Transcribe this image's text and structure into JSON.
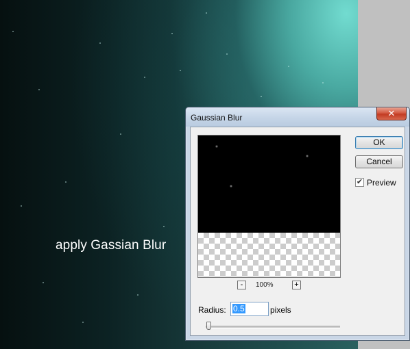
{
  "canvas": {
    "caption": "apply Gassian Blur"
  },
  "dialog": {
    "title": "Gaussian Blur",
    "close_icon": "close-icon",
    "ok_label": "OK",
    "cancel_label": "Cancel",
    "preview_checkbox": {
      "label": "Preview",
      "checked": true
    },
    "zoom": {
      "minus": "-",
      "level": "100%",
      "plus": "+"
    },
    "radius": {
      "label": "Radius:",
      "value": "0.5",
      "unit": "pixels",
      "slider_fraction": 0.005
    }
  },
  "colors": {
    "titlebar": "#c7d6e8",
    "close_button": "#c9442c",
    "accent_selection": "#3399ff",
    "canvas_glow": "#6ddcd2"
  }
}
